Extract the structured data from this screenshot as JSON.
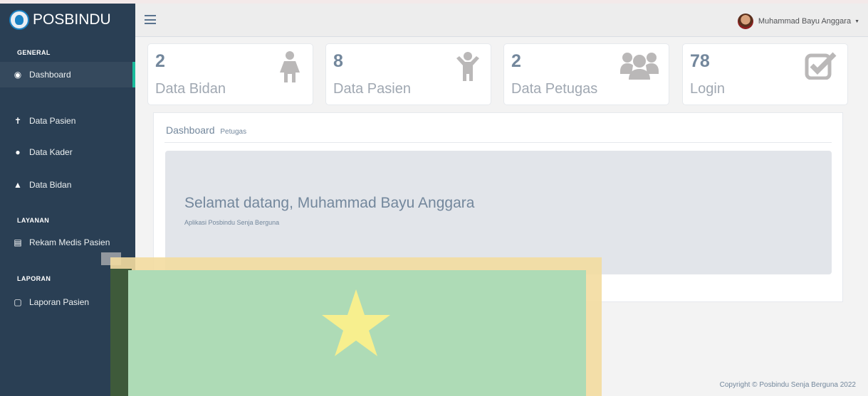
{
  "brand": {
    "name": "POSBINDU"
  },
  "sidebar": {
    "sections": {
      "general": "GENERAL",
      "layanan": "LAYANAN",
      "laporan": "LAPORAN"
    },
    "items": [
      {
        "label": "Dashboard",
        "icon": "dashboard-icon"
      },
      {
        "label": "Data Pasien",
        "icon": "child-icon"
      },
      {
        "label": "Data Kader",
        "icon": "users-icon"
      },
      {
        "label": "Data Bidan",
        "icon": "user-icon"
      },
      {
        "label": "Rekam Medis Pasien",
        "icon": "file-icon"
      },
      {
        "label": "Laporan Pasien",
        "icon": "pdf-file-icon"
      }
    ]
  },
  "topbar": {
    "user_name": "Muhammad Bayu Anggara"
  },
  "tiles": [
    {
      "count": "2",
      "label": "Data Bidan",
      "icon": "female-icon"
    },
    {
      "count": "8",
      "label": "Data Pasien",
      "icon": "child-icon"
    },
    {
      "count": "2",
      "label": "Data Petugas",
      "icon": "users-icon"
    },
    {
      "count": "78",
      "label": "Login",
      "icon": "check-square-icon"
    }
  ],
  "panel": {
    "title": "Dashboard",
    "subtitle": "Petugas",
    "welcome": "Selamat datang, Muhammad Bayu Anggara",
    "app_name": "Aplikasi Posbindu Senja Berguna"
  },
  "footer": {
    "copyright": "Copyright © Posbindu Senja Berguna 2022"
  },
  "colors": {
    "sidebar": "#2a3f54",
    "accent": "#1abb9c",
    "overlay_green": "#aedbb6",
    "overlay_star": "#f7ef8e"
  }
}
